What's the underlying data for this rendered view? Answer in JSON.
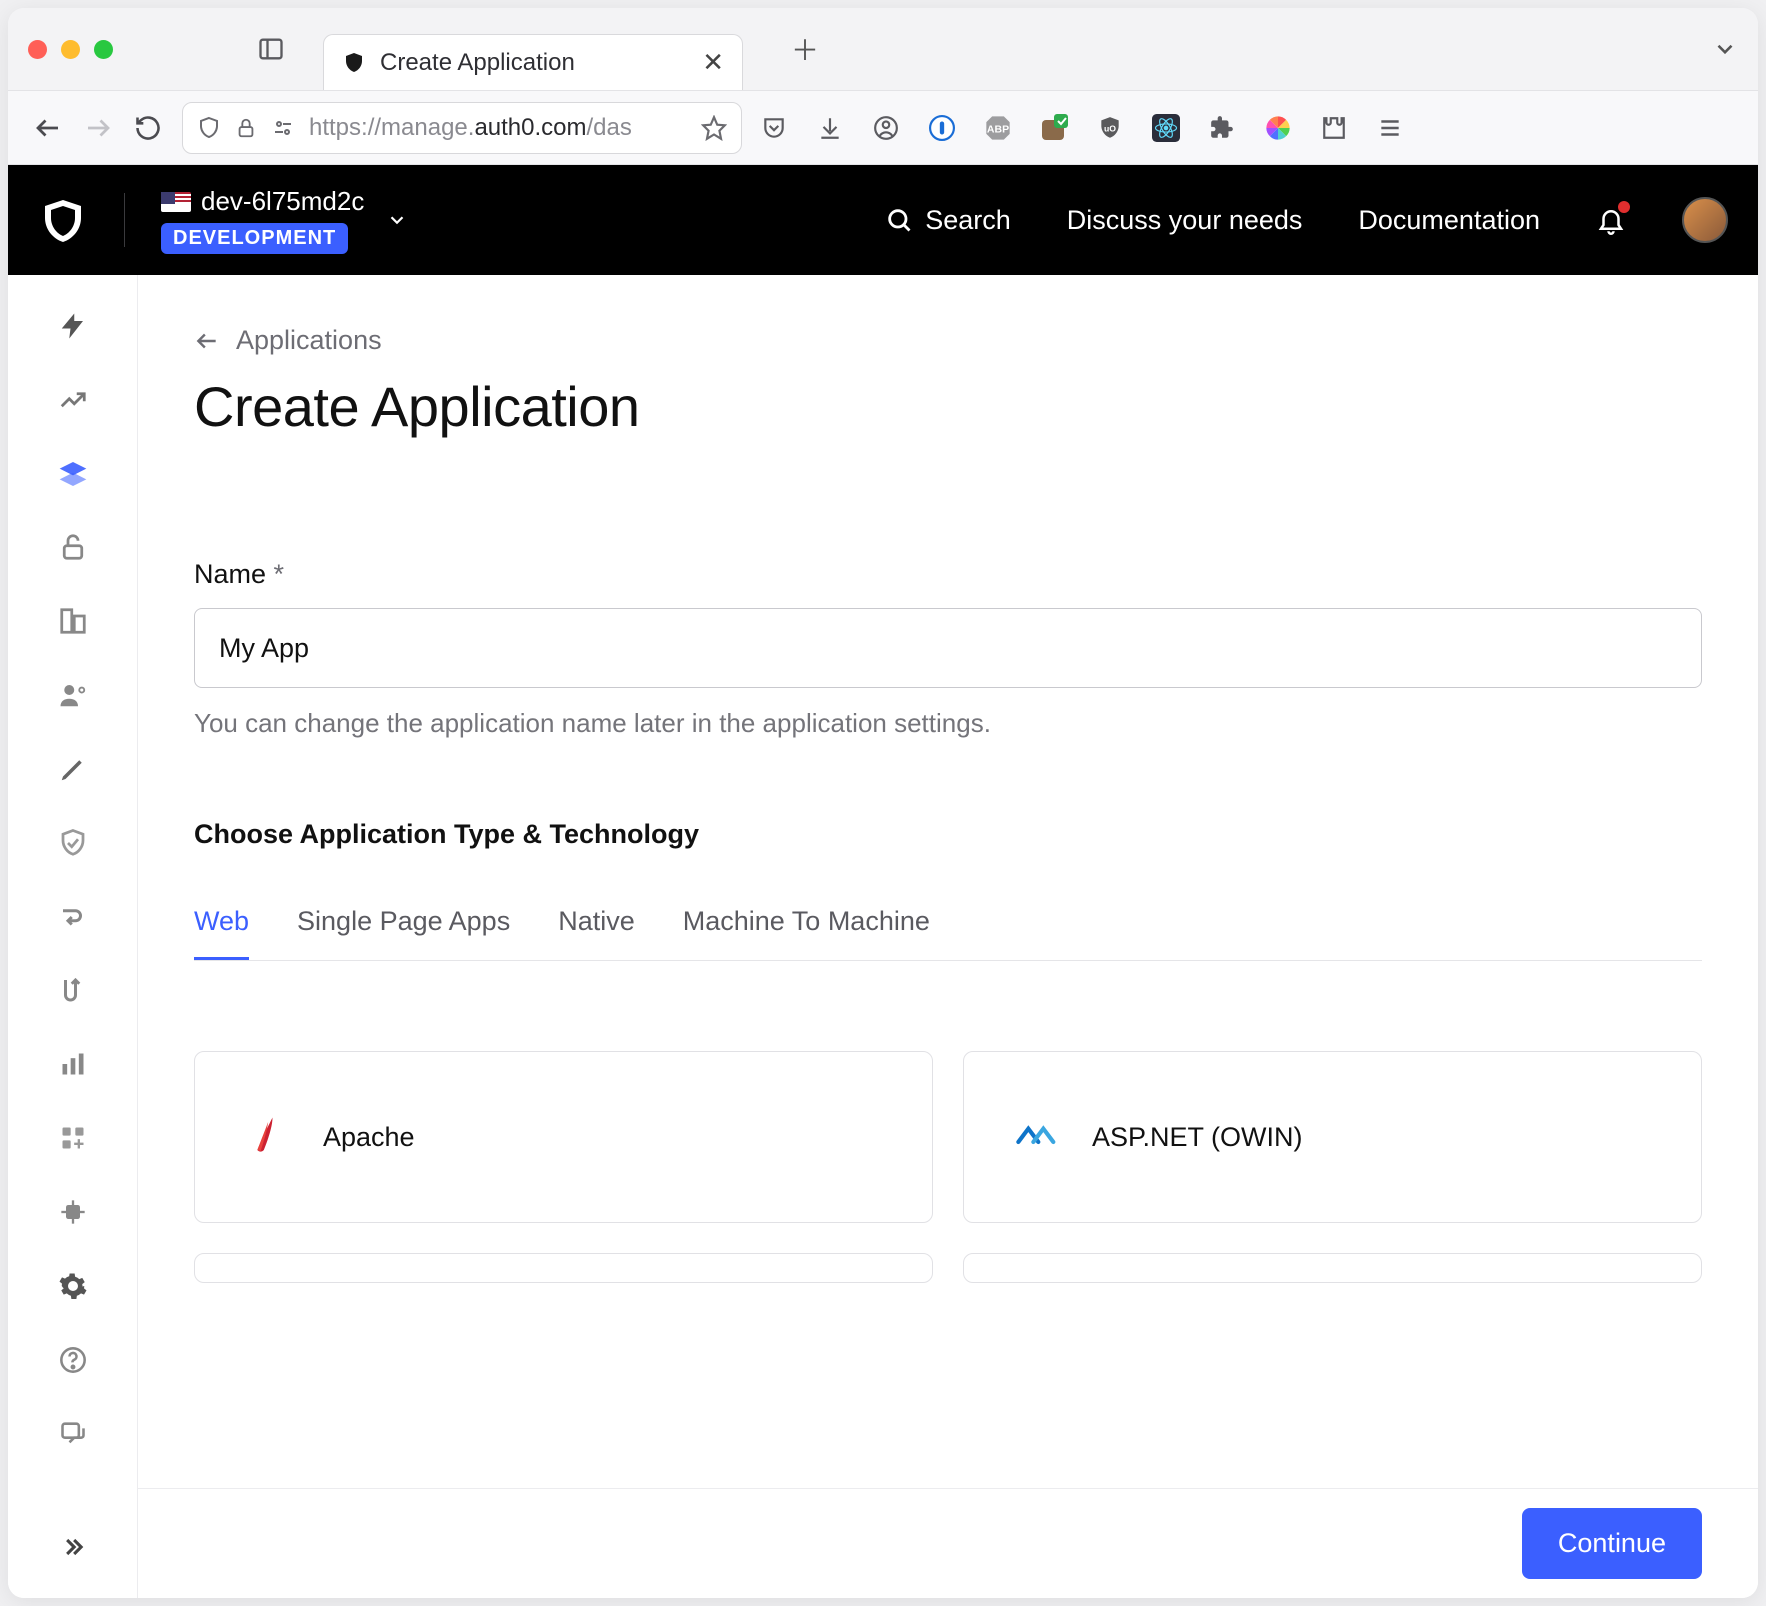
{
  "browser": {
    "tab_title": "Create Application",
    "url_prefix": "https://manage.",
    "url_bold": "auth0.com",
    "url_suffix": "/das"
  },
  "topbar": {
    "tenant_name": "dev-6l75md2c",
    "env_badge": "DEVELOPMENT",
    "search_label": "Search",
    "discuss_label": "Discuss your needs",
    "docs_label": "Documentation"
  },
  "breadcrumb": {
    "parent": "Applications"
  },
  "page": {
    "title": "Create Application",
    "name_label": "Name",
    "name_required_marker": "*",
    "name_value": "My App",
    "name_help": "You can change the application name later in the application settings.",
    "type_section_label": "Choose Application Type & Technology",
    "tabs": [
      "Web",
      "Single Page Apps",
      "Native",
      "Machine To Machine"
    ],
    "active_tab_index": 0,
    "technologies": [
      {
        "name": "Apache",
        "icon": "apache"
      },
      {
        "name": "ASP.NET (OWIN)",
        "icon": "aspnet"
      }
    ],
    "continue_label": "Continue"
  }
}
